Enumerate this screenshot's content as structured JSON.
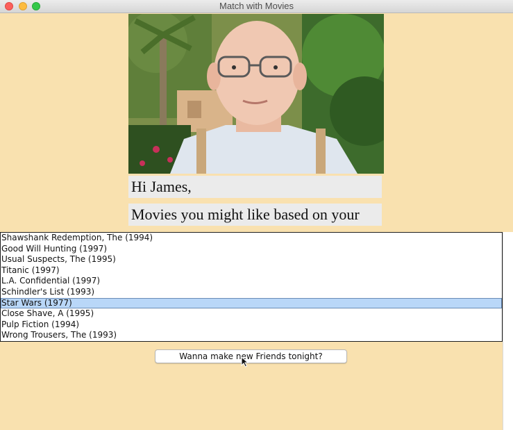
{
  "window": {
    "title": "Match with Movies"
  },
  "greeting": {
    "hi": "Hi James,",
    "subtitle": "Movies you might like based on your"
  },
  "movies": {
    "items": [
      "Shawshank Redemption, The (1994)",
      "Good Will Hunting (1997)",
      "Usual Suspects, The (1995)",
      "Titanic (1997)",
      "L.A. Confidential (1997)",
      "Schindler's List (1993)",
      "Star Wars (1977)",
      "Close Shave, A (1995)",
      "Pulp Fiction (1994)",
      "Wrong Trousers, The (1993)"
    ],
    "selected_index": 6
  },
  "actions": {
    "friends_button": "Wanna make new Friends tonight?"
  },
  "colors": {
    "background": "#f9e1af",
    "selection": "#b9d7f8"
  }
}
